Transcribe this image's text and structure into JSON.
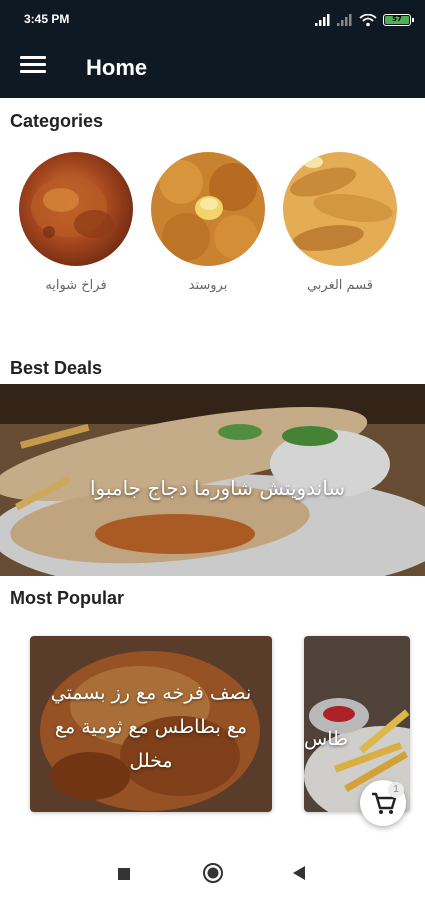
{
  "status_bar": {
    "time": "3:45 PM",
    "battery": "57"
  },
  "app_bar": {
    "title": "Home"
  },
  "categories": {
    "title": "Categories",
    "items": [
      {
        "label": "فراخ شوايه",
        "icon": "grilled-chicken"
      },
      {
        "label": "بروستد",
        "icon": "broasted-chicken"
      },
      {
        "label": "قسم الغربي",
        "icon": "western-section"
      }
    ]
  },
  "best_deals": {
    "title": "Best Deals",
    "banner_text": "ساندويتش شاورما دجاج جامبوا"
  },
  "most_popular": {
    "title": "Most Popular",
    "items": [
      {
        "text": "نصف فرخه مع رز بسمتي مع بطاطس مع ثومية مع مخلل"
      },
      {
        "text": "طاس"
      }
    ]
  },
  "cart": {
    "count": "1"
  },
  "colors": {
    "app_bar": "#0f1923",
    "battery": "#4caf50"
  }
}
